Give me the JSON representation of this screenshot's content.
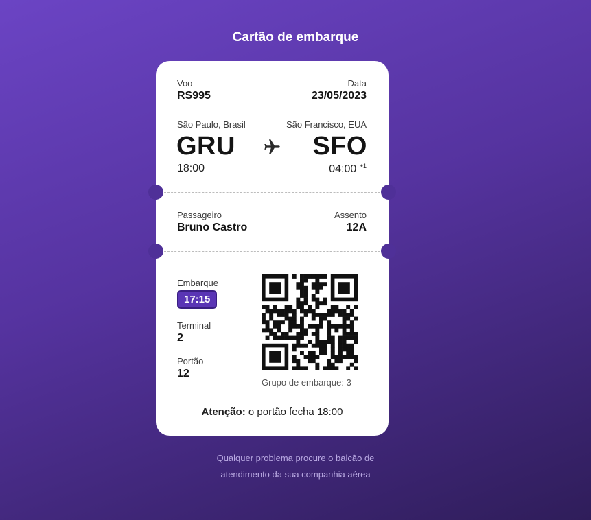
{
  "page": {
    "title": "Cartão de embarque"
  },
  "flight": {
    "label": "Voo",
    "number": "RS995",
    "date_label": "Data",
    "date": "23/05/2023"
  },
  "route": {
    "origin_city": "São Paulo, Brasil",
    "origin_code": "GRU",
    "origin_time": "18:00",
    "dest_city": "São Francisco, EUA",
    "dest_code": "SFO",
    "dest_time": "04:00",
    "dest_day_offset": "+1",
    "icon": "airplane-icon"
  },
  "passenger": {
    "label": "Passageiro",
    "name": "Bruno Castro",
    "seat_label": "Assento",
    "seat": "12A"
  },
  "boarding": {
    "label": "Embarque",
    "time": "17:15",
    "terminal_label": "Terminal",
    "terminal": "2",
    "gate_label": "Portão",
    "gate": "12",
    "group_text": "Grupo de embarque: 3"
  },
  "notice": {
    "bold": "Atenção:",
    "text": "o portão fecha 18:00"
  },
  "footer": {
    "line1": "Qualquer problema procure o balcão de",
    "line2": "atendimento da sua companhia aérea"
  },
  "colors": {
    "accent": "#5a35b5",
    "background_top": "#6b44c4",
    "background_bottom": "#2f1d5a"
  }
}
